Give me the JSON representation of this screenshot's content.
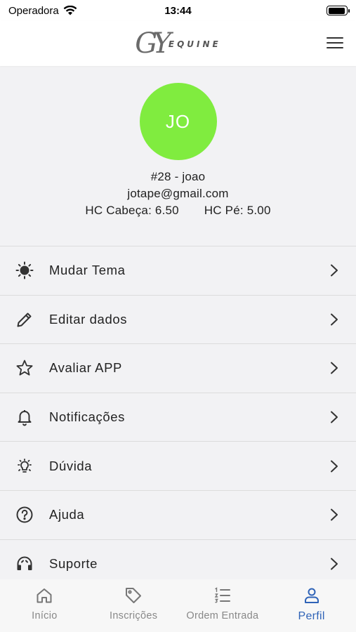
{
  "status_bar": {
    "carrier": "Operadora",
    "time": "13:44",
    "battery_level": 0.95
  },
  "header": {
    "logo_mark": "GY",
    "logo_text": "EQUINE"
  },
  "profile": {
    "avatar_initials": "JO",
    "avatar_color": "#80ec3f",
    "id_name": "#28 - joao",
    "email": "jotape@gmail.com",
    "hc_cabeca": "HC Cabeça: 6.50",
    "hc_pe": "HC Pé: 5.00"
  },
  "menu": {
    "items": [
      {
        "label": "Mudar Tema",
        "icon": "sun-icon"
      },
      {
        "label": "Editar dados",
        "icon": "pencil-icon"
      },
      {
        "label": "Avaliar APP",
        "icon": "star-icon"
      },
      {
        "label": "Notificações",
        "icon": "bell-icon"
      },
      {
        "label": "Dúvida",
        "icon": "lightbulb-icon"
      },
      {
        "label": "Ajuda",
        "icon": "help-circle-icon"
      },
      {
        "label": "Suporte",
        "icon": "headset-icon"
      }
    ]
  },
  "tabs": {
    "active_color": "#2f63b7",
    "inactive_color": "#777777",
    "items": [
      {
        "label": "Início",
        "icon": "home-icon"
      },
      {
        "label": "Inscrições",
        "icon": "tag-icon"
      },
      {
        "label": "Ordem Entrada",
        "icon": "ordered-list-icon"
      },
      {
        "label": "Perfil",
        "icon": "person-icon"
      }
    ],
    "active_index": 3
  }
}
